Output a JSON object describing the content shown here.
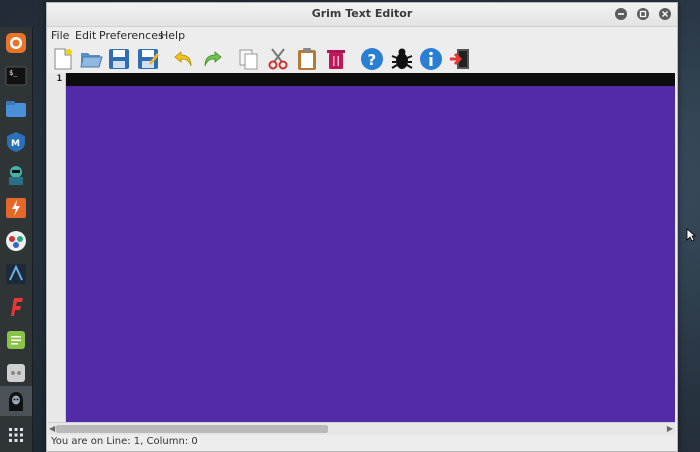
{
  "window": {
    "title": "Grim Text Editor"
  },
  "menu": [
    "File",
    "Edit",
    "Preferences",
    "Help"
  ],
  "toolbar": [
    {
      "icon": "new-file-icon",
      "label": "New"
    },
    {
      "icon": "open-folder-icon",
      "label": "Open"
    },
    {
      "icon": "save-icon",
      "label": "Save"
    },
    {
      "icon": "save-as-icon",
      "label": "Save As"
    },
    {
      "icon": "undo-icon",
      "label": "Undo"
    },
    {
      "icon": "redo-icon",
      "label": "Redo"
    },
    {
      "icon": "copy-icon",
      "label": "Copy"
    },
    {
      "icon": "cut-icon",
      "label": "Cut"
    },
    {
      "icon": "paste-icon",
      "label": "Paste"
    },
    {
      "icon": "delete-icon",
      "label": "Delete"
    },
    {
      "icon": "help-icon",
      "label": "Help"
    },
    {
      "icon": "bug-icon",
      "label": "Report Bug"
    },
    {
      "icon": "info-icon",
      "label": "About"
    },
    {
      "icon": "exit-icon",
      "label": "Exit"
    }
  ],
  "editor": {
    "line_number": "1",
    "background": "#522ca8",
    "current_line_color": "#0d0d0d"
  },
  "status": {
    "text": "You are on Line: 1, Column: 0"
  },
  "dock": [
    "firefox-icon",
    "terminal-icon",
    "files-icon",
    "metasploit-icon",
    "armitage-icon",
    "burpsuite-icon",
    "maltego-icon",
    "beef-icon",
    "faraday-icon",
    "notes-icon",
    "settings-icon",
    "grim-reaper-icon",
    "apps-grid-icon"
  ]
}
